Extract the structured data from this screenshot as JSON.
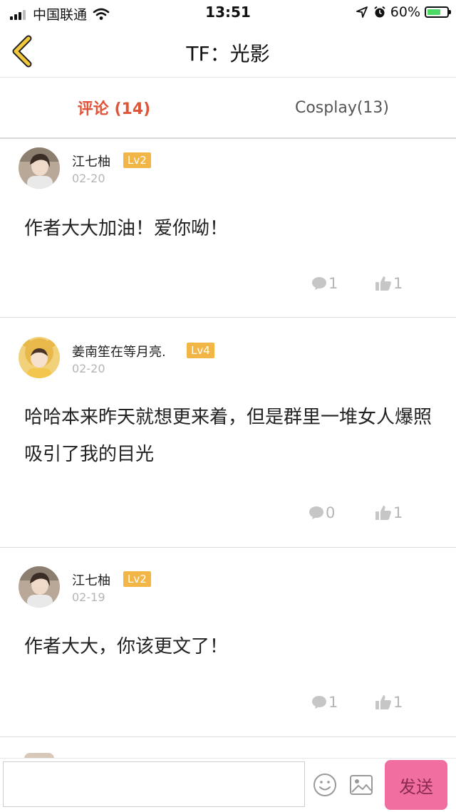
{
  "status_bar": {
    "carrier": "中国联通",
    "time": "13:51",
    "battery": "60%"
  },
  "nav": {
    "title": "TF：光影"
  },
  "tabs": [
    {
      "label": "评论 (14)",
      "active": true
    },
    {
      "label": "Cosplay(13)",
      "active": false
    }
  ],
  "comments": [
    {
      "user": "江七柚",
      "level": "Lv2",
      "date": "02-20",
      "content": "作者大大加油！爱你呦！",
      "replies": "1",
      "likes": "1"
    },
    {
      "user": "姜南笙在等月亮.",
      "level": "Lv4",
      "date": "02-20",
      "content": "哈哈本来昨天就想更来着，但是群里一堆女人爆照吸引了我的目光",
      "replies": "0",
      "likes": "1"
    },
    {
      "user": "江七柚",
      "level": "Lv2",
      "date": "02-19",
      "content": "作者大大，你该更文了！",
      "replies": "1",
      "likes": "1"
    }
  ],
  "composer": {
    "placeholder": "",
    "send_label": "发送"
  },
  "colors": {
    "accent": "#e0543a",
    "badge": "#f2b646",
    "send": "#f06ea0",
    "back_arrow": "#f3c83a"
  },
  "icons": {
    "back": "chevron-left-icon",
    "reply": "comment-bubble-icon",
    "like": "thumbs-up-icon",
    "emoji": "smiley-icon",
    "image": "image-icon"
  }
}
